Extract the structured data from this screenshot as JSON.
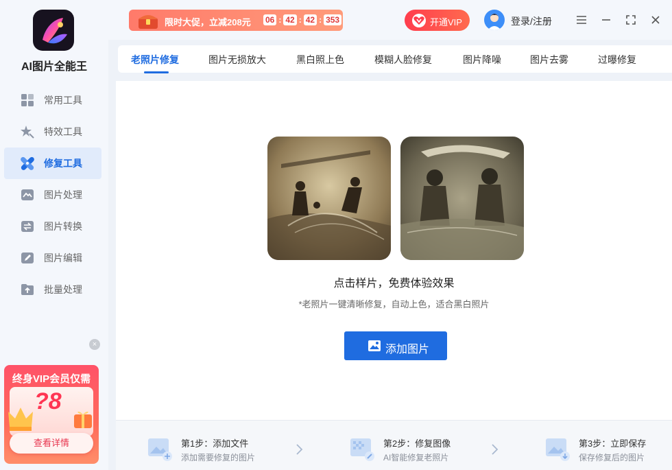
{
  "app": {
    "name": "AI图片全能王"
  },
  "sidebar": {
    "items": [
      {
        "label": "常用工具",
        "icon": "grid-icon"
      },
      {
        "label": "特效工具",
        "icon": "star-wand-icon"
      },
      {
        "label": "修复工具",
        "icon": "bandage-icon",
        "active": true
      },
      {
        "label": "图片处理",
        "icon": "image-icon"
      },
      {
        "label": "图片转换",
        "icon": "convert-icon"
      },
      {
        "label": "图片编辑",
        "icon": "edit-icon"
      },
      {
        "label": "批量处理",
        "icon": "batch-upload-icon"
      }
    ]
  },
  "vip_card": {
    "title": "终身VIP会员仅需",
    "price": "?8",
    "button": "查看详情"
  },
  "topbar": {
    "promo_text": "限时大促，立减208元",
    "timer": [
      "06",
      "42",
      "42",
      "353"
    ],
    "vip_button": "开通VIP",
    "login": "登录/注册"
  },
  "tabs": [
    {
      "label": "老照片修复",
      "active": true
    },
    {
      "label": "图片无损放大"
    },
    {
      "label": "黑白照上色"
    },
    {
      "label": "模糊人脸修复"
    },
    {
      "label": "图片降噪"
    },
    {
      "label": "图片去雾"
    },
    {
      "label": "过曝修复"
    }
  ],
  "main": {
    "caption": "点击样片，免费体验效果",
    "description": "*老照片一键清晰修复，自动上色，适合黑白照片",
    "add_button": "添加图片"
  },
  "steps": [
    {
      "title": "第1步：添加文件",
      "subtitle": "添加需要修复的图片"
    },
    {
      "title": "第2步：修复图像",
      "subtitle": "AI智能修复老照片"
    },
    {
      "title": "第3步：立即保存",
      "subtitle": "保存修复后的图片"
    }
  ],
  "colors": {
    "accent": "#1f6ce0",
    "vip_red": "#ff3d4d",
    "sidebar_bg": "#f4f7fc"
  }
}
